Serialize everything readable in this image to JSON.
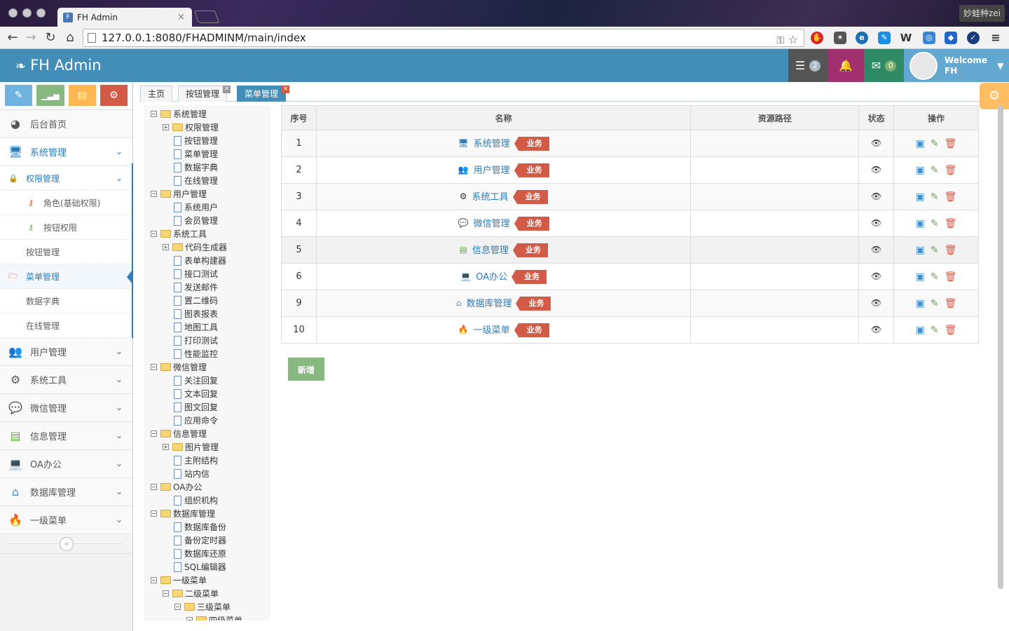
{
  "browser": {
    "tab_title": "FH Admin",
    "user_chip": "妙蛙种zei",
    "url": "127.0.0.1:8080/FHADMINM/main/index"
  },
  "navbar": {
    "brand": "FH Admin",
    "tasks_count": "2",
    "mail_count": "0",
    "welcome": "Welcome",
    "user": "FH"
  },
  "sidebar": {
    "home": "后台首页",
    "system": "系统管理",
    "perm": "权限管理",
    "role": "角色(基础权限)",
    "button_perm": "按钮权限",
    "button_mgr": "按钮管理",
    "menu_mgr": "菜单管理",
    "dict": "数据字典",
    "online": "在线管理",
    "user": "用户管理",
    "tools": "系统工具",
    "wechat": "微信管理",
    "info": "信息管理",
    "oa": "OA办公",
    "db": "数据库管理",
    "level1": "一级菜单"
  },
  "tabs": [
    "主页",
    "按钮管理",
    "菜单管理"
  ],
  "tree": [
    {
      "label": "系统管理",
      "level": 0,
      "type": "folder",
      "toggle": "⊟"
    },
    {
      "label": "权限管理",
      "level": 1,
      "type": "folder",
      "toggle": "⊞"
    },
    {
      "label": "按钮管理",
      "level": 1,
      "type": "file"
    },
    {
      "label": "菜单管理",
      "level": 1,
      "type": "file"
    },
    {
      "label": "数据字典",
      "level": 1,
      "type": "file"
    },
    {
      "label": "在线管理",
      "level": 1,
      "type": "file"
    },
    {
      "label": "用户管理",
      "level": 0,
      "type": "folder",
      "toggle": "⊟"
    },
    {
      "label": "系统用户",
      "level": 1,
      "type": "file"
    },
    {
      "label": "会员管理",
      "level": 1,
      "type": "file"
    },
    {
      "label": "系统工具",
      "level": 0,
      "type": "folder",
      "toggle": "⊟"
    },
    {
      "label": "代码生成器",
      "level": 1,
      "type": "folder",
      "toggle": "⊞"
    },
    {
      "label": "表单构建器",
      "level": 1,
      "type": "file"
    },
    {
      "label": "接口测试",
      "level": 1,
      "type": "file"
    },
    {
      "label": "发送邮件",
      "level": 1,
      "type": "file"
    },
    {
      "label": "置二维码",
      "level": 1,
      "type": "file"
    },
    {
      "label": "图表报表",
      "level": 1,
      "type": "file"
    },
    {
      "label": "地图工具",
      "level": 1,
      "type": "file"
    },
    {
      "label": "打印测试",
      "level": 1,
      "type": "file"
    },
    {
      "label": "性能监控",
      "level": 1,
      "type": "file"
    },
    {
      "label": "微信管理",
      "level": 0,
      "type": "folder",
      "toggle": "⊟"
    },
    {
      "label": "关注回复",
      "level": 1,
      "type": "file"
    },
    {
      "label": "文本回复",
      "level": 1,
      "type": "file"
    },
    {
      "label": "图文回复",
      "level": 1,
      "type": "file"
    },
    {
      "label": "应用命令",
      "level": 1,
      "type": "file"
    },
    {
      "label": "信息管理",
      "level": 0,
      "type": "folder",
      "toggle": "⊟"
    },
    {
      "label": "图片管理",
      "level": 1,
      "type": "folder",
      "toggle": "⊞"
    },
    {
      "label": "主附结构",
      "level": 1,
      "type": "file"
    },
    {
      "label": "站内信",
      "level": 1,
      "type": "file"
    },
    {
      "label": "OA办公",
      "level": 0,
      "type": "folder",
      "toggle": "⊟"
    },
    {
      "label": "组织机构",
      "level": 1,
      "type": "file"
    },
    {
      "label": "数据库管理",
      "level": 0,
      "type": "folder",
      "toggle": "⊟"
    },
    {
      "label": "数据库备份",
      "level": 1,
      "type": "file"
    },
    {
      "label": "备份定时器",
      "level": 1,
      "type": "file"
    },
    {
      "label": "数据库还原",
      "level": 1,
      "type": "file"
    },
    {
      "label": "SQL编辑器",
      "level": 1,
      "type": "file"
    },
    {
      "label": "一级菜单",
      "level": 0,
      "type": "folder",
      "toggle": "⊟"
    },
    {
      "label": "二级菜单",
      "level": 1,
      "type": "folder",
      "toggle": "⊟"
    },
    {
      "label": "三级菜单",
      "level": 2,
      "type": "folder",
      "toggle": "⊟"
    },
    {
      "label": "四级菜单",
      "level": 3,
      "type": "folder",
      "toggle": "⊟"
    }
  ],
  "table": {
    "headers": [
      "序号",
      "名称",
      "资源路径",
      "状态",
      "操作"
    ],
    "tag": "业务",
    "rows": [
      {
        "no": "1",
        "name": "系统管理",
        "icon": "desktop-icon",
        "glyph": "🖥",
        "color": "#2b7dbc",
        "path": ""
      },
      {
        "no": "2",
        "name": "用户管理",
        "icon": "users-icon",
        "glyph": "👥",
        "color": "#2b7dbc",
        "path": ""
      },
      {
        "no": "3",
        "name": "系统工具",
        "icon": "cog-icon",
        "glyph": "⚙",
        "color": "#333333",
        "path": ""
      },
      {
        "no": "4",
        "name": "微信管理",
        "icon": "comments-icon",
        "glyph": "💬",
        "color": "#a069c3",
        "path": ""
      },
      {
        "no": "5",
        "name": "信息管理",
        "icon": "credit-card-icon",
        "glyph": "▤",
        "color": "#69aa46",
        "path": ""
      },
      {
        "no": "6",
        "name": "OA办公",
        "icon": "laptop-icon",
        "glyph": "💻",
        "color": "#c6699f",
        "path": ""
      },
      {
        "no": "9",
        "name": "数据库管理",
        "icon": "hdd-icon",
        "glyph": "⌂",
        "color": "#478fca",
        "path": ""
      },
      {
        "no": "10",
        "name": "一级菜单",
        "icon": "fire-icon",
        "glyph": "🔥",
        "color": "#e8590c",
        "path": ""
      }
    ]
  },
  "add_button": "新增"
}
